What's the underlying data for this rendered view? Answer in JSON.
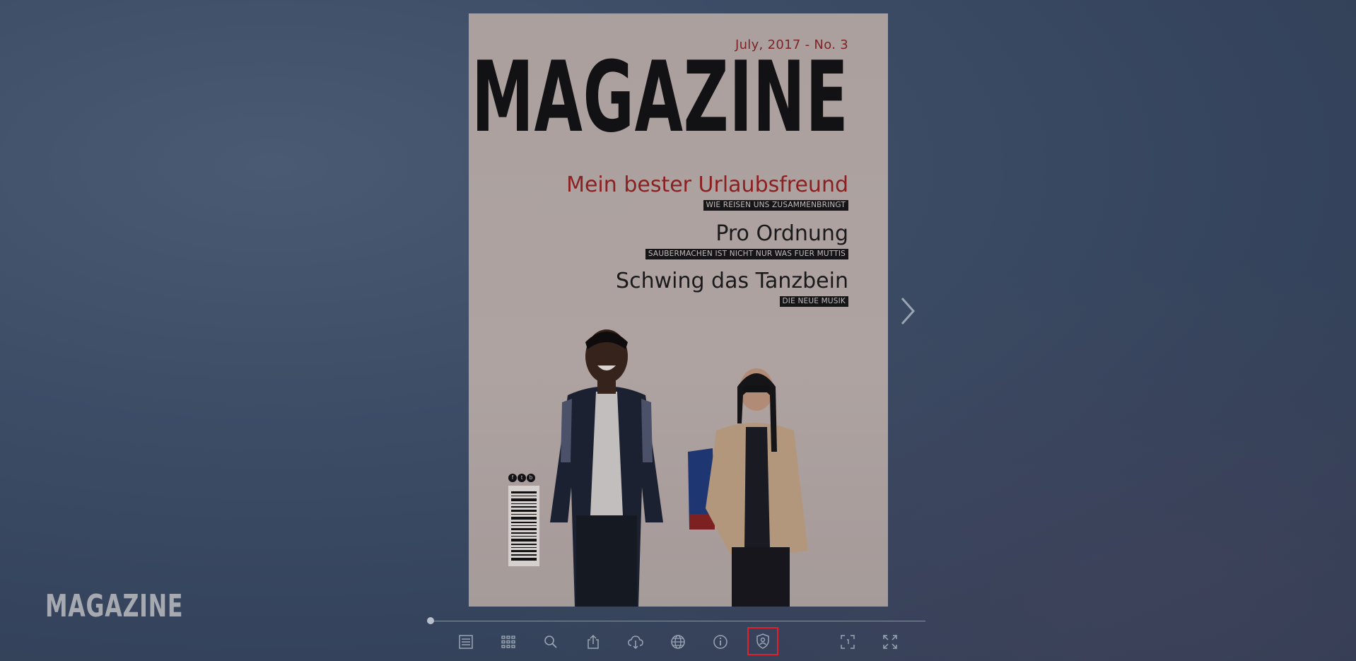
{
  "app": {
    "brand_logo": "MAGAZINE"
  },
  "cover": {
    "dateline": "July, 2017 - No. 3",
    "masthead": "MAGAZINE",
    "stories": [
      {
        "headline": "Mein bester Urlaubsfreund",
        "kicker": "WIE REISEN UNS ZUSAMMENBRINGT",
        "color": "#9a2020"
      },
      {
        "headline": "Pro Ordnung",
        "kicker": "SAUBERMACHEN IST NICHT NUR WAS FUER MUTTIS",
        "color": "#1a1a1a"
      },
      {
        "headline": "Schwing das Tanzbein",
        "kicker": "DIE NEUE MUSIK",
        "color": "#1a1a1a"
      }
    ],
    "social_icons": [
      "f",
      "t",
      "b"
    ]
  },
  "navigation": {
    "next_icon": "chevron-right-icon"
  },
  "progress": {
    "page_position_fraction": 0.0
  },
  "toolbar": {
    "buttons": [
      {
        "icon": "table-of-contents-icon"
      },
      {
        "icon": "thumbnails-grid-icon"
      },
      {
        "icon": "search-icon"
      },
      {
        "icon": "share-icon"
      },
      {
        "icon": "cloud-download-icon"
      },
      {
        "icon": "language-globe-icon"
      },
      {
        "icon": "info-icon"
      },
      {
        "icon": "privacy-shield-icon",
        "active": true
      },
      {
        "icon": "fit-page-icon"
      },
      {
        "icon": "fullscreen-icon"
      }
    ],
    "active_border_color": "#e0202a"
  }
}
